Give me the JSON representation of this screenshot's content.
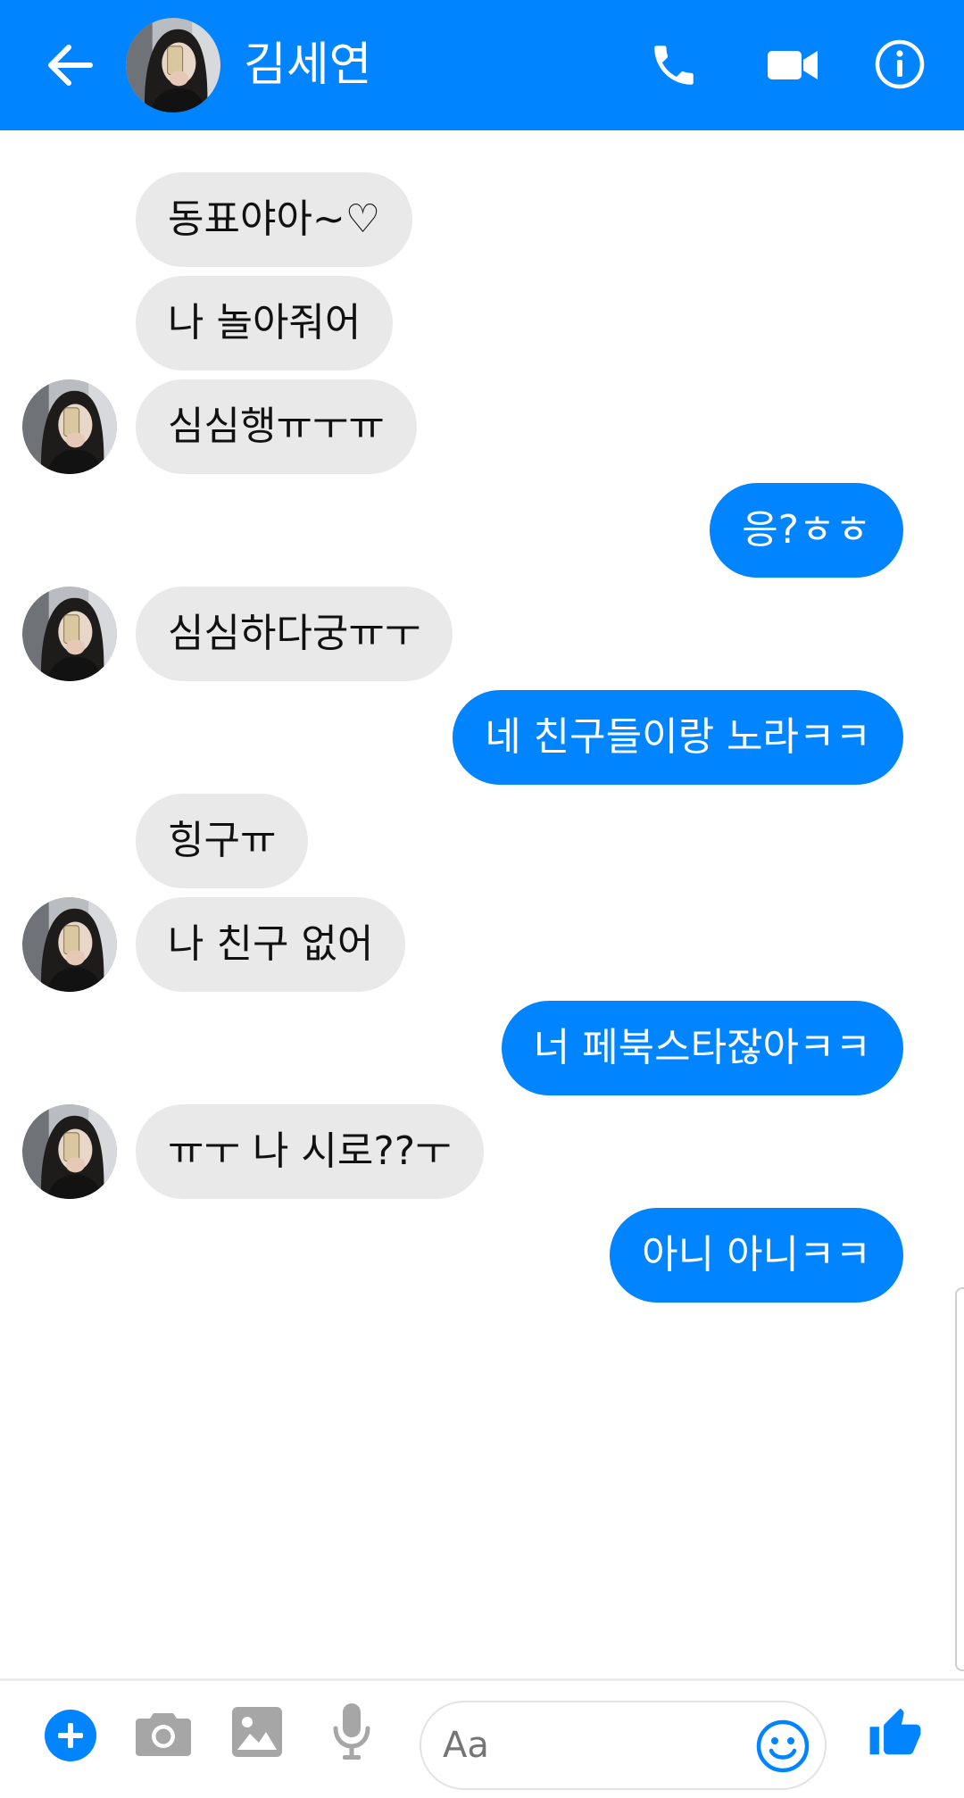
{
  "header": {
    "contact_name": "김세연",
    "icons": [
      "back-arrow-icon",
      "phone-icon",
      "video-camera-icon",
      "info-icon"
    ]
  },
  "messages": [
    {
      "from": "them",
      "text": "동표야아~♡"
    },
    {
      "from": "them",
      "text": "나 놀아줘어"
    },
    {
      "from": "them",
      "text": "심심행ㅠㅜㅠ"
    },
    {
      "from": "me",
      "text": "응?ㅎㅎ"
    },
    {
      "from": "them",
      "text": "심심하다궁ㅠㅜ"
    },
    {
      "from": "me",
      "text": "네 친구들이랑 노라ㅋㅋ"
    },
    {
      "from": "them",
      "text": "힝구ㅠ"
    },
    {
      "from": "them",
      "text": "나 친구 없어"
    },
    {
      "from": "me",
      "text": "너 페북스타잖아ㅋㅋ"
    },
    {
      "from": "them",
      "text": "ㅠㅜ 나 시로??ㅜ"
    },
    {
      "from": "me",
      "text": "아니 아니ㅋㅋ"
    }
  ],
  "composer": {
    "placeholder": "Aa",
    "icons": [
      "plus-icon",
      "camera-icon",
      "gallery-icon",
      "microphone-icon",
      "emoji-icon",
      "thumbs-up-icon"
    ]
  },
  "colors": {
    "accent": "#0084ff",
    "incoming_bubble": "#e9e9e9",
    "outgoing_text": "#ffffff"
  }
}
